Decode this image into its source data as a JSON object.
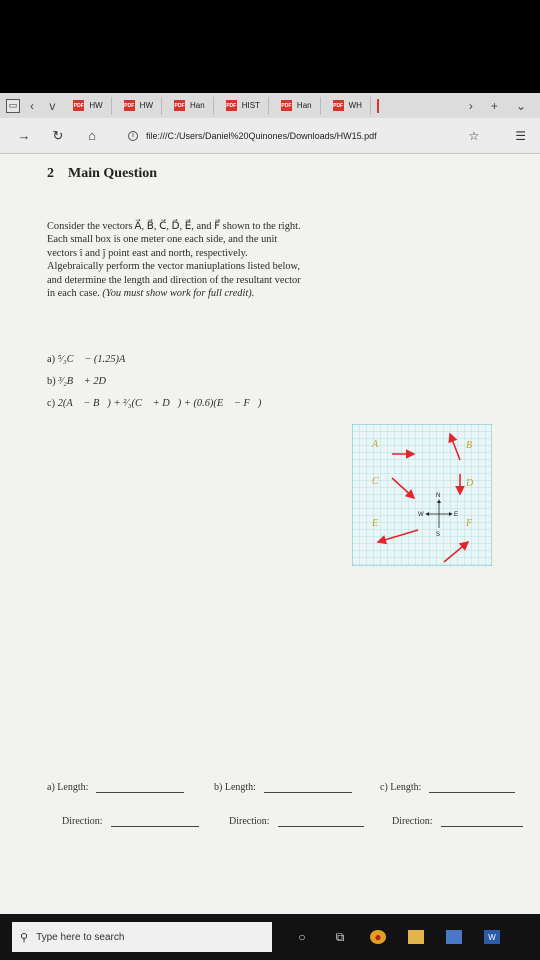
{
  "browser": {
    "tabs": [
      {
        "label": "HW",
        "pdf": false
      },
      {
        "label": "HW",
        "pdf": true
      },
      {
        "label": "Han",
        "pdf": true
      },
      {
        "label": "HIST",
        "pdf": true
      },
      {
        "label": "Han",
        "pdf": true
      },
      {
        "label": "WH",
        "pdf": true
      }
    ],
    "url": "file:///C:/Users/Daniel%20Quinones/Downloads/HW15.pdf"
  },
  "document": {
    "section_number": "2",
    "section_title": "Main Question",
    "paragraph": "Consider the vectors A⃗, B⃗, C⃗, D⃗, E⃗, and F⃗ shown to the right. Each small box is one meter one each side, and the unit vectors î and ĵ point east and north, respectively. Algebraically perform the vector maniuplations listed below, and determine the length and direction of the resultant vector in each case.",
    "instruction": "(You must show work for full credit).",
    "parts": [
      {
        "label": "a)",
        "expr": "⁵⁄₃C⃗ − (1.25)A⃗"
      },
      {
        "label": "b)",
        "expr": "³⁄₂B⃗ + 2D⃗"
      },
      {
        "label": "c)",
        "expr": "2(A⃗ − B⃗) + ²⁄₃(C⃗ + D⃗) + (0.6)(E⃗ − F⃗)"
      }
    ],
    "figure_labels": {
      "A": "A⃗",
      "B": "B⃗",
      "C": "C⃗",
      "D": "D⃗",
      "E": "E⃗",
      "F": "F⃗",
      "N": "N",
      "S": "S",
      "E_dir": "E",
      "W": "W"
    },
    "answers": {
      "a_length": "a) Length:",
      "b_length": "b) Length:",
      "c_length": "c) Length:",
      "direction": "Direction:"
    }
  },
  "taskbar": {
    "search_placeholder": "Type here to search"
  },
  "colors": {
    "grid": "#4fb6c4",
    "arrow": "#e2262e",
    "label": "#c9a020"
  }
}
